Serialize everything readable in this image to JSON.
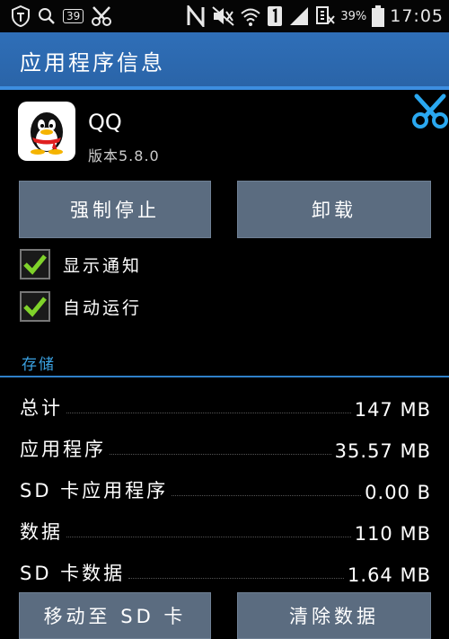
{
  "status_bar": {
    "notification_count": "39",
    "battery_percent": "39%",
    "time": "17:05",
    "icons": [
      "shield-icon",
      "search-icon",
      "badge-icon",
      "scissors-icon",
      "n-icon",
      "mute-icon",
      "wifi-icon",
      "sim-icon",
      "signal-icon",
      "data-icon",
      "battery-icon"
    ]
  },
  "header": {
    "title": "应用程序信息"
  },
  "app": {
    "name": "QQ",
    "version": "版本5.8.0",
    "icon": "qq-penguin-icon"
  },
  "buttons": {
    "force_stop": "强制停止",
    "uninstall": "卸载",
    "move_to_sd": "移动至 SD 卡",
    "clear_data": "清除数据"
  },
  "options": [
    {
      "label": "显示通知",
      "checked": true
    },
    {
      "label": "自动运行",
      "checked": true
    }
  ],
  "storage": {
    "section_label": "存储",
    "rows": [
      {
        "label": "总计",
        "value": "147 MB"
      },
      {
        "label": "应用程序",
        "value": "35.57 MB"
      },
      {
        "label": "SD 卡应用程序",
        "value": "0.00 B"
      },
      {
        "label": "数据",
        "value": "110 MB"
      },
      {
        "label": "SD 卡数据",
        "value": "1.64 MB"
      }
    ]
  },
  "colors": {
    "title_bar": "#2f6fb8",
    "accent": "#3aa0e0",
    "button": "#5b6c80",
    "check": "#7fd22a"
  }
}
